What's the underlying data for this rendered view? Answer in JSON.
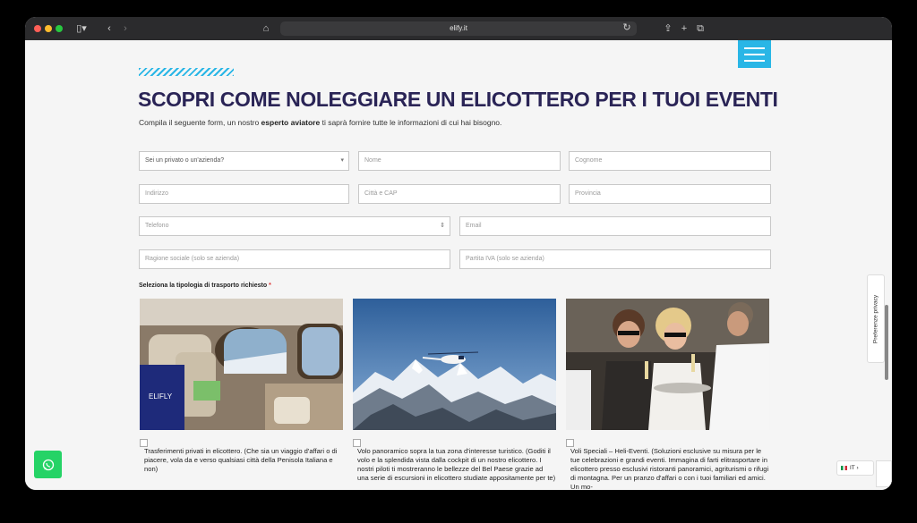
{
  "browser": {
    "url": "elify.it"
  },
  "page": {
    "heading": "SCOPRI COME NOLEGGIARE UN ELICOTTERO PER I TUOI EVENTI",
    "subtitle_before": "Compila il seguente form, un nostro ",
    "subtitle_bold": "esperto aviatore",
    "subtitle_after": " ti saprà fornire tutte le informazioni di cui hai bisogno."
  },
  "form": {
    "select_type": "Sei un privato o un'azienda?",
    "nome": "Nome",
    "cognome": "Cognome",
    "indirizzo": "Indirizzo",
    "citta_cap": "Città e CAP",
    "provincia": "Provincia",
    "telefono": "Telefono",
    "email": "Email",
    "ragione_sociale": "Ragione sociale (solo se azienda)",
    "partita_iva": "Partita IVA (solo se azienda)",
    "transport_label": "Seleziona la tipologia di trasporto richiesto",
    "required_mark": "*"
  },
  "cards": [
    {
      "text": "Trasferimenti privati in elicottero. (Che sia un viaggio d'affari o di piacere, vola da e verso qualsiasi città della Penisola Italiana e non)"
    },
    {
      "text": "Volo panoramico sopra la tua zona d'interesse turistico. (Goditi il volo e la splendida vista dalla cockpit di un nostro elicottero. I nostri piloti ti mostreranno le bellezze del Bel Paese grazie ad una serie di escursioni in elicottero studiate appositamente per te)"
    },
    {
      "text": "Voli Speciali – Heli-Eventi. (Soluzioni esclusive su misura per le tue celebrazioni e grandi eventi. Immagina di farti elitrasportare in elicottero presso esclusivi ristoranti panoramici, agriturismi o rifugi di montagna. Per un pranzo d'affari o con i tuoi familiari ed amici. Un mo-"
    }
  ],
  "widgets": {
    "privacy_label": "Preferenze privacy",
    "language": "IT"
  },
  "colors": {
    "accent": "#29b6e6",
    "heading": "#2a2456",
    "whatsapp": "#25d366"
  }
}
